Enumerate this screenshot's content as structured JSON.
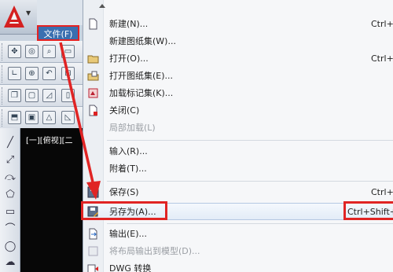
{
  "app": {
    "menu_tab_label": "文件(F)",
    "viewport_label": "[一][俯视][二"
  },
  "menu": {
    "items": [
      {
        "label": "新建(N)...",
        "shortcut": "Ctrl+",
        "icon": "new-document-icon"
      },
      {
        "label": "新建图纸集(W)...",
        "shortcut": "",
        "icon": ""
      },
      {
        "label": "打开(O)...",
        "shortcut": "Ctrl+",
        "icon": "open-folder-icon"
      },
      {
        "label": "打开图纸集(E)...",
        "shortcut": "",
        "icon": "open-sheet-set-icon"
      },
      {
        "label": "加载标记集(K)...",
        "shortcut": "",
        "icon": "markup-set-icon"
      },
      {
        "label": "关闭(C)",
        "shortcut": "",
        "icon": "close-document-icon"
      },
      {
        "label": "局部加载(L)",
        "shortcut": "",
        "icon": "",
        "disabled": true
      },
      {
        "label": "输入(R)...",
        "shortcut": "",
        "icon": ""
      },
      {
        "label": "附着(T)...",
        "shortcut": "",
        "icon": ""
      },
      {
        "label": "保存(S)",
        "shortcut": "Ctrl+",
        "icon": "save-disk-icon"
      },
      {
        "label": "另存为(A)...",
        "shortcut": "Ctrl+Shift+",
        "icon": "save-as-icon",
        "highlighted": true
      },
      {
        "label": "输出(E)...",
        "shortcut": "",
        "icon": "export-icon"
      },
      {
        "label": "将布局输出到模型(D)...",
        "shortcut": "",
        "icon": "export-layout-icon",
        "disabled": true
      },
      {
        "label": "DWG 转换",
        "shortcut": "",
        "icon": "dwg-convert-icon"
      }
    ]
  },
  "colors": {
    "annotation_red": "#e02424",
    "menu_highlight": "#e3ecf7",
    "file_tab": "#3a6fb0"
  }
}
